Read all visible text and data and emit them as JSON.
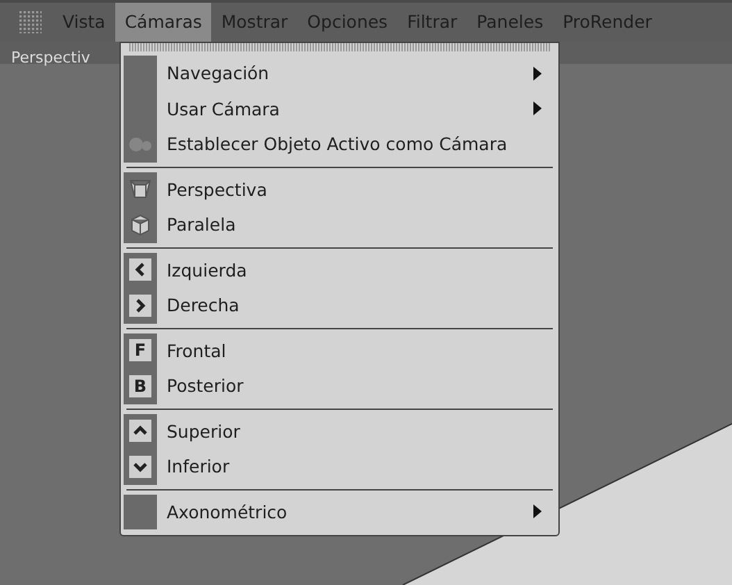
{
  "menubar": [
    {
      "label": "Vista",
      "selected": false
    },
    {
      "label": "Cámaras",
      "selected": true
    },
    {
      "label": "Mostrar",
      "selected": false
    },
    {
      "label": "Opciones",
      "selected": false
    },
    {
      "label": "Filtrar",
      "selected": false
    },
    {
      "label": "Paneles",
      "selected": false
    },
    {
      "label": "ProRender",
      "selected": false
    }
  ],
  "viewport": {
    "title": "Perspectiv"
  },
  "menu": {
    "groups": [
      [
        {
          "label": "Navegación",
          "kind": "plain",
          "submenu": true
        },
        {
          "label": "Usar Cámara",
          "kind": "plain",
          "submenu": true
        },
        {
          "label": "Establecer Objeto Activo como Cámara",
          "kind": "camera",
          "submenu": false
        }
      ],
      [
        {
          "label": "Perspectiva",
          "kind": "perspective",
          "submenu": false
        },
        {
          "label": "Paralela",
          "kind": "parallel",
          "submenu": false
        }
      ],
      [
        {
          "label": "Izquierda",
          "kind": "left",
          "submenu": false
        },
        {
          "label": "Derecha",
          "kind": "right",
          "submenu": false
        }
      ],
      [
        {
          "label": "Frontal",
          "kind": "letter",
          "icon_text": "F",
          "submenu": false
        },
        {
          "label": "Posterior",
          "kind": "letter",
          "icon_text": "B",
          "submenu": false
        }
      ],
      [
        {
          "label": "Superior",
          "kind": "up",
          "submenu": false
        },
        {
          "label": "Inferior",
          "kind": "down",
          "submenu": false
        }
      ],
      [
        {
          "label": "Axonométrico",
          "kind": "plain",
          "submenu": true
        }
      ]
    ]
  }
}
